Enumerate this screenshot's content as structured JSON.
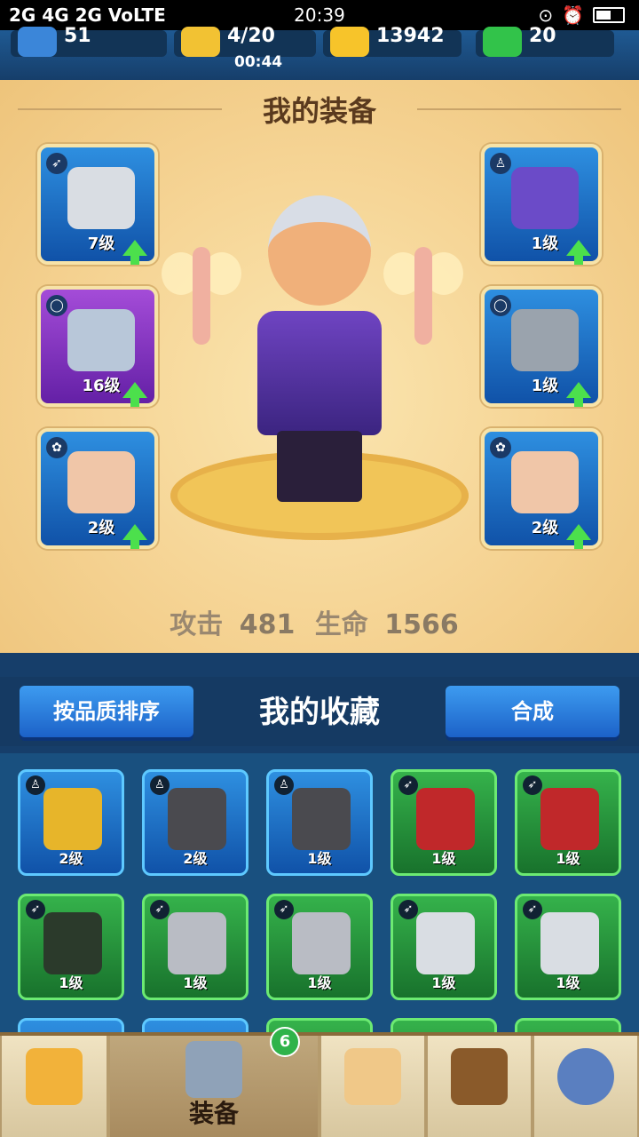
{
  "status": {
    "carrier": "2G 4G 2G VoLTE",
    "time": "20:39"
  },
  "resources": {
    "level": "51",
    "energy": "4/20",
    "timer": "00:44",
    "gold": "13942",
    "gems": "20"
  },
  "equipment": {
    "title": "我的装备",
    "left_slots": [
      {
        "level": "7级"
      },
      {
        "level": "16级"
      },
      {
        "level": "2级"
      }
    ],
    "right_slots": [
      {
        "level": "1级"
      },
      {
        "level": "1级"
      },
      {
        "level": "2级"
      }
    ],
    "stats": {
      "atk_label": "攻击",
      "atk_value": "481",
      "hp_label": "生命",
      "hp_value": "1566"
    }
  },
  "collection": {
    "sort_button": "按品质排序",
    "title": "我的收藏",
    "merge_button": "合成",
    "row1": [
      "2级",
      "2级",
      "1级",
      "1级",
      "1级"
    ],
    "row2": [
      "1级",
      "1级",
      "1级",
      "1级",
      "1级"
    ]
  },
  "nav": {
    "equip_label": "装备",
    "equip_badge": "6"
  }
}
